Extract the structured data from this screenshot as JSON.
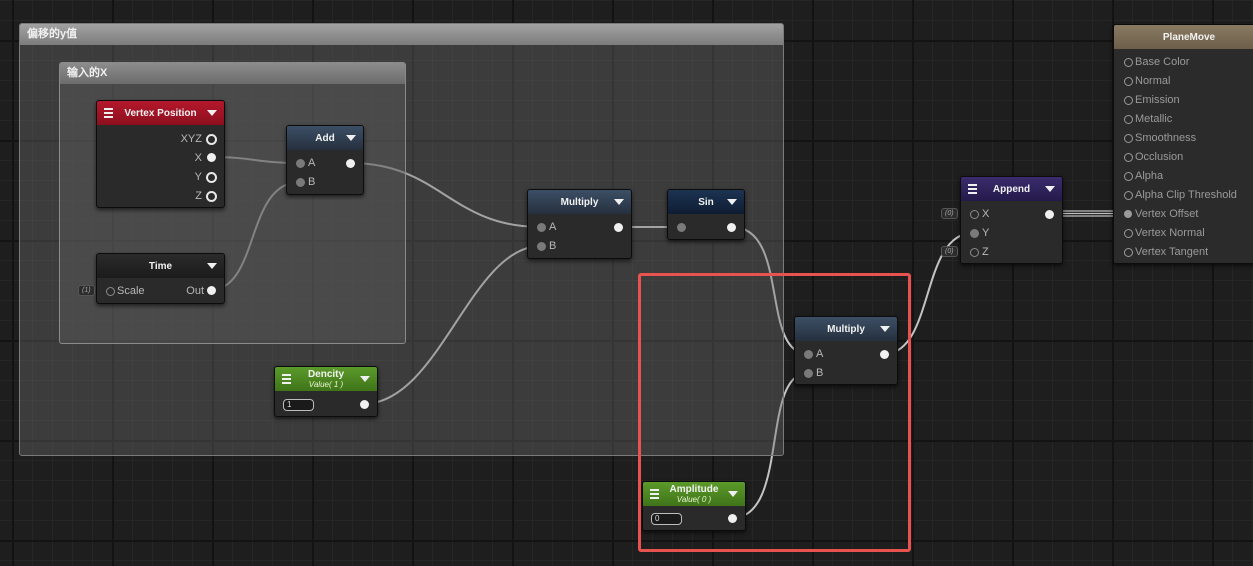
{
  "groups": {
    "outer_title": "偏移的y值",
    "inner_title": "输入的X"
  },
  "nodes": {
    "vertex_position": {
      "title": "Vertex Position",
      "outputs": [
        "XYZ",
        "X",
        "Y",
        "Z"
      ]
    },
    "time": {
      "title": "Time",
      "input": "Scale",
      "output": "Out",
      "scale_default": "(1)"
    },
    "add": {
      "title": "Add",
      "inputs": [
        "A",
        "B"
      ]
    },
    "multiply_1": {
      "title": "Multiply",
      "inputs": [
        "A",
        "B"
      ]
    },
    "sin": {
      "title": "Sin"
    },
    "dencity": {
      "title": "Dencity",
      "subtitle": "Value( 1 )",
      "value": "1"
    },
    "multiply_2": {
      "title": "Multiply",
      "inputs": [
        "A",
        "B"
      ]
    },
    "amplitude": {
      "title": "Amplitude",
      "subtitle": "Value( 0 )",
      "value": "0"
    },
    "append": {
      "title": "Append",
      "inputs": [
        "X",
        "Y",
        "Z"
      ],
      "x_default": "(0)",
      "z_default": "(0)"
    },
    "plane_move": {
      "title": "PlaneMove",
      "inputs": [
        "Base Color",
        "Normal",
        "Emission",
        "Metallic",
        "Smoothness",
        "Occlusion",
        "Alpha",
        "Alpha Clip Threshold",
        "Vertex Offset",
        "Vertex Normal",
        "Vertex Tangent"
      ]
    }
  },
  "colors": {
    "highlight": "#e8534f",
    "wire": "#c8c8c8",
    "vertex_position_header": "#b4182c",
    "property_header": "#5b9a2a",
    "append_header": "#3a2c6e",
    "master_header": "#8a7a62"
  }
}
